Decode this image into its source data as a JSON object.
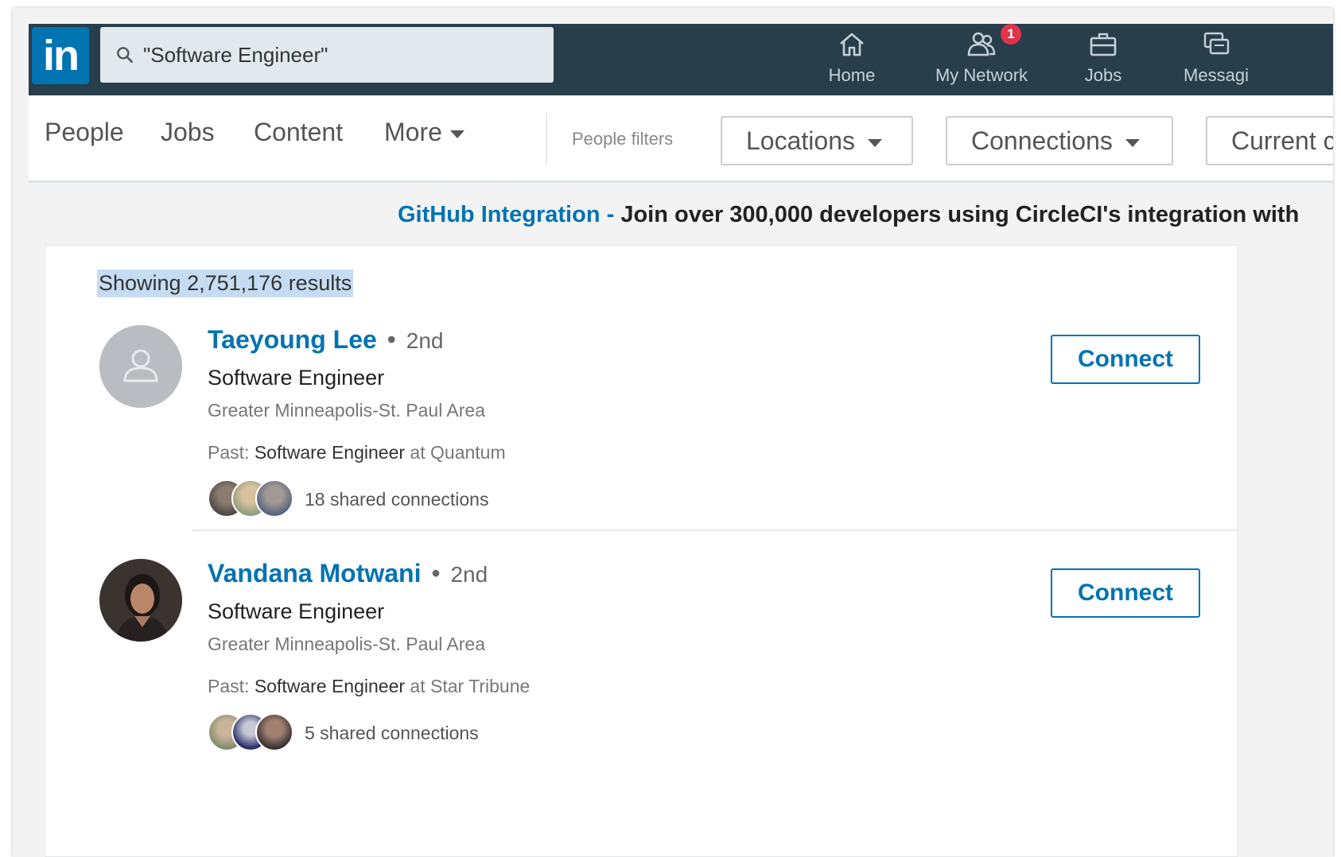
{
  "nav": {
    "logo": "in",
    "search_value": "\"Software Engineer\"",
    "items": [
      {
        "label": "Home",
        "icon": "home-icon"
      },
      {
        "label": "My Network",
        "icon": "my-network-icon",
        "badge": "1"
      },
      {
        "label": "Jobs",
        "icon": "jobs-icon"
      },
      {
        "label": "Messagi",
        "icon": "messaging-icon"
      }
    ]
  },
  "filters": {
    "tabs": [
      "People",
      "Jobs",
      "Content",
      "More"
    ],
    "people_filters_label": "People filters",
    "buttons": [
      "Locations",
      "Connections",
      "Current c"
    ]
  },
  "ad": {
    "link": "GitHub Integration",
    "separator": " - ",
    "text": "Join over 300,000 developers using CircleCI's integration with"
  },
  "results": {
    "count_text": "Showing 2,751,176 results",
    "items": [
      {
        "name": "Taeyoung Lee",
        "separator": "•",
        "degree": "2nd",
        "headline": "Software Engineer",
        "location": "Greater Minneapolis-St. Paul Area",
        "past_prefix": "Past: ",
        "past_role": "Software Engineer",
        "past_suffix": " at Quantum",
        "shared": "18 shared connections",
        "action": "Connect"
      },
      {
        "name": "Vandana Motwani",
        "separator": "•",
        "degree": "2nd",
        "headline": "Software Engineer",
        "location": "Greater Minneapolis-St. Paul Area",
        "past_prefix": "Past: ",
        "past_role": "Software Engineer",
        "past_suffix": " at Star Tribune",
        "shared": "5 shared connections",
        "action": "Connect"
      }
    ]
  },
  "colors": {
    "nav_bg": "#283e4a",
    "brand_blue": "#0073b1",
    "badge_red": "#e0344a",
    "highlight": "#c5dcf3"
  }
}
